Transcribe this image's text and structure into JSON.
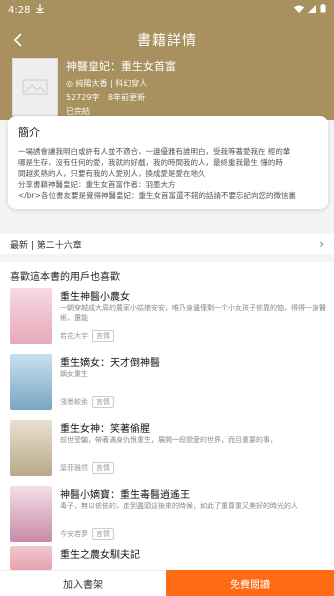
{
  "status": {
    "time": "4:28",
    "icons": [
      "download-icon",
      "wifi-icon",
      "signal-icon",
      "battery-icon"
    ]
  },
  "header": {
    "title": "書籍詳情"
  },
  "book": {
    "title": "神醫皇妃：重生女首富",
    "author": "純陽大香 | 科幻穿人",
    "words": "52729字",
    "updated": "8年前更新",
    "status": "已完結"
  },
  "intro": {
    "heading": "簡介",
    "lines": [
      "一場誘會讓我明白或許有人並不適合，一邊優雅有誰明白，受我等著愛我在 經的輩",
      "哪是生存，沒有任何的愛，我就的好戲，我的時間我的人，最終重我最生 懂的時",
      "間越炙熱的人，只要有我的人愛別人，換成愛是愛在地久",
      "分享書籍神醫皇妃：重生女首富作者：羽墨大方",
      "</br>各位書友要是覺得神醫皇妃：重生女首富還不錯的話請不要忘記向您的微信裏"
    ]
  },
  "latest": {
    "label": "最新 | 第二十六章"
  },
  "recommend": {
    "heading": "喜歡這本書的用戶也喜歡",
    "items": [
      {
        "name": "重生神醫小農女",
        "desc": "一朝穿越成大周的農家小姑娘安安，唯乃身邊僅剩一个小女孩子依靠的恤，得得一身醫術，還能",
        "author": "若花大宇",
        "tag": "言情"
      },
      {
        "name": "重生嫡女：天才倒神醫",
        "desc": "嫡女重生",
        "author": "淺墨軟柔",
        "tag": "言情"
      },
      {
        "name": "重生女神：笑著偷腥",
        "desc": "前世受騙，帶著滿身仇恨重生，展開一段戀愛的世界，而且重要的事，",
        "author": "葉菲雅然",
        "tag": "言情"
      },
      {
        "name": "神醫小嫡寶：重生毒醫逍遙王",
        "desc": "毒子，無以依依的，走到盡頭這後來的時候，如此了重尊重又美好的時光的人",
        "author": "今安若夢",
        "tag": "言情"
      },
      {
        "name": "重生之農女馴夫記",
        "desc": "",
        "author": "",
        "tag": ""
      }
    ]
  },
  "bottom": {
    "add_shelf": "加入書架",
    "read_free": "免費閱讀"
  },
  "colors": {
    "brand": "#a8915f",
    "accent": "#ff6a14"
  }
}
